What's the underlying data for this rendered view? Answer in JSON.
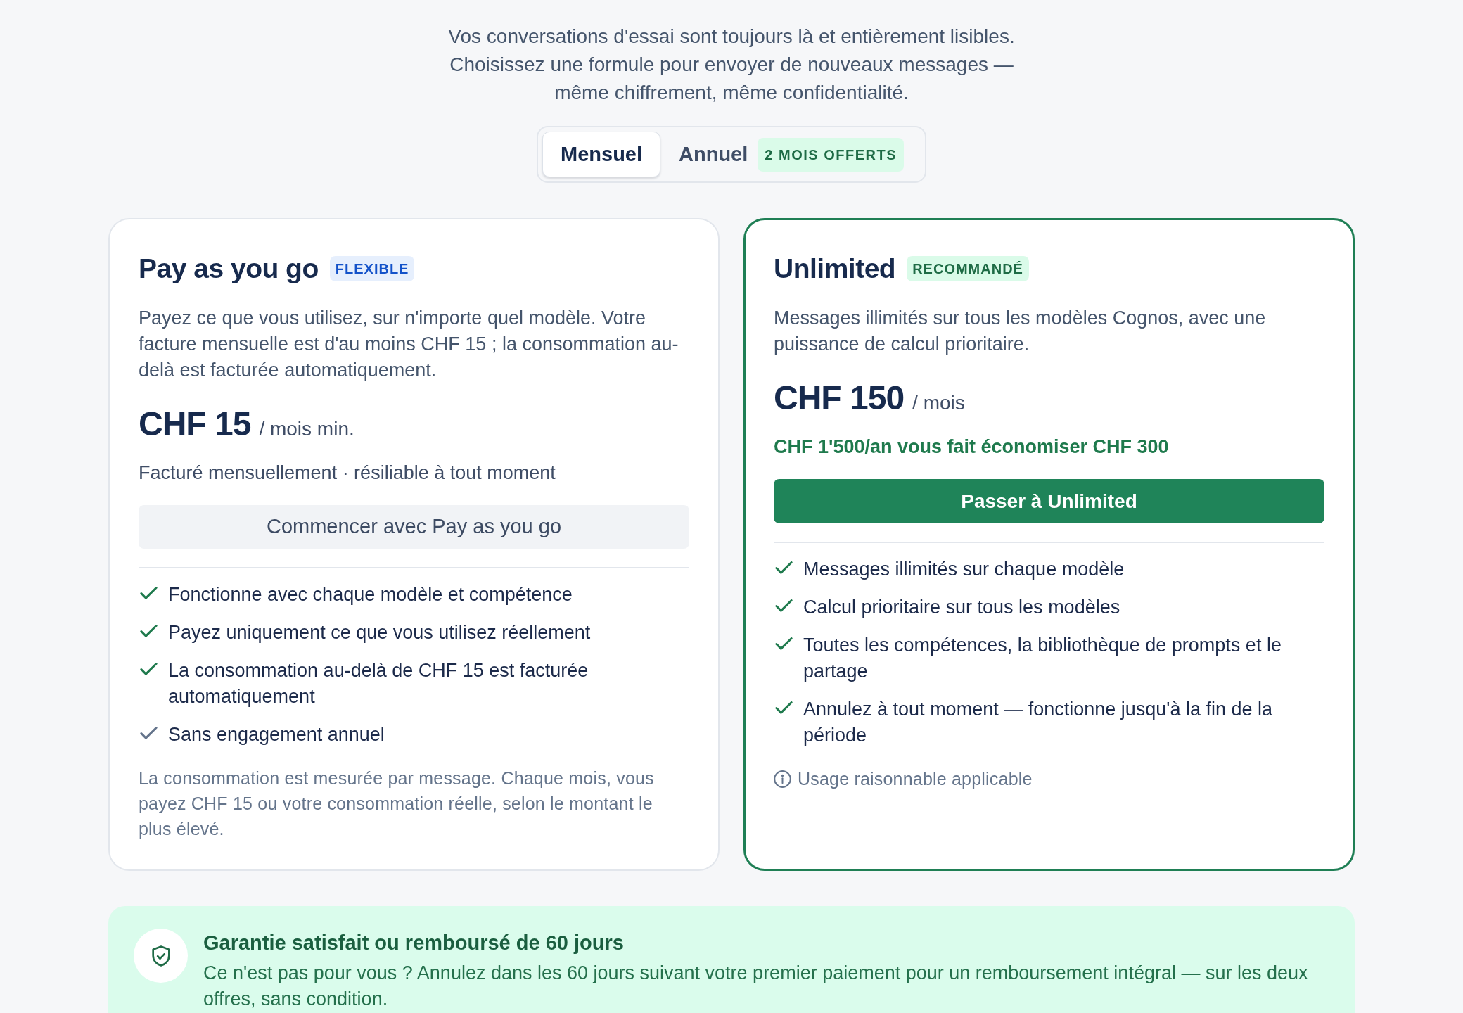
{
  "intro": {
    "lines": [
      "Vos conversations d'essai sont toujours là et entièrement lisibles.",
      "Choisissez une formule pour envoyer de nouveaux messages —",
      "même chiffrement, même confidentialité."
    ]
  },
  "billing_toggle": {
    "options": [
      {
        "label": "Mensuel",
        "selected": true
      },
      {
        "label": "Annuel",
        "selected": false,
        "badge": "2 MOIS OFFERTS"
      }
    ]
  },
  "plans": [
    {
      "name": "Pay as you go",
      "badge": "FLEXIBLE",
      "featured": false,
      "description": "Payez ce que vous utilisez, sur n'importe quel modèle. Votre facture mensuelle est d'au moins CHF 15 ; la consommation au-delà est facturée automatiquement.",
      "price": "CHF 15",
      "price_unit": "/ mois min.",
      "subline": {
        "kind": "billing",
        "text": "Facturé mensuellement · résiliable à tout moment"
      },
      "button": "Commencer avec Pay as you go",
      "features": [
        {
          "text": "Fonctionne avec chaque modèle et compétence",
          "color": "#1f7a4d"
        },
        {
          "text": "Payez uniquement ce que vous utilisez réellement",
          "color": "#1f7a4d"
        },
        {
          "text": "La consommation au-delà de CHF 15 est facturée automatiquement",
          "color": "#1f7a4d"
        },
        {
          "text": "Sans engagement annuel",
          "color": "#64748b"
        }
      ],
      "note": {
        "kind": "plain",
        "text": "La consommation est mesurée par message. Chaque mois, vous payez CHF 15 ou votre consommation réelle, selon le montant le plus élevé."
      }
    },
    {
      "name": "Unlimited",
      "badge": "RECOMMANDÉ",
      "featured": true,
      "description": "Messages illimités sur tous les modèles Cognos, avec une puissance de calcul prioritaire.",
      "price": "CHF 150",
      "price_unit": "/ mois",
      "subline": {
        "kind": "savings",
        "text": "CHF 1'500/an vous fait économiser CHF 300"
      },
      "button": "Passer à Unlimited",
      "features": [
        {
          "text": "Messages illimités sur chaque modèle",
          "color": "#1f7a4d"
        },
        {
          "text": "Calcul prioritaire sur tous les modèles",
          "color": "#1f7a4d"
        },
        {
          "text": "Toutes les compétences, la bibliothèque de prompts et le partage",
          "color": "#1f7a4d"
        },
        {
          "text": "Annulez à tout moment — fonctionne jusqu'à la fin de la période",
          "color": "#1f7a4d"
        }
      ],
      "note": {
        "kind": "info",
        "text": "Usage raisonnable applicable"
      }
    }
  ],
  "guarantee": {
    "title": "Garantie satisfait ou remboursé de 60 jours",
    "text": "Ce n'est pas pour vous ? Annulez dans les 60 jours suivant votre premier paiement pour un remboursement intégral — sur les deux offres, sans condition."
  }
}
